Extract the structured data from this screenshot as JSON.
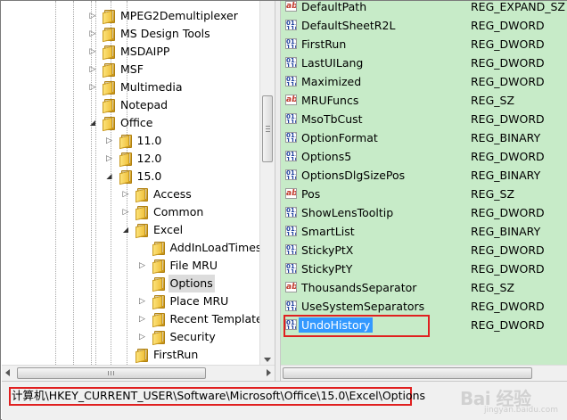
{
  "tree": {
    "items": [
      {
        "label": "MPEG2Demultiplexer",
        "depth": 0,
        "twisty": "collapsed"
      },
      {
        "label": "MS Design Tools",
        "depth": 0,
        "twisty": "collapsed"
      },
      {
        "label": "MSDAIPP",
        "depth": 0,
        "twisty": "collapsed"
      },
      {
        "label": "MSF",
        "depth": 0,
        "twisty": "collapsed"
      },
      {
        "label": "Multimedia",
        "depth": 0,
        "twisty": "collapsed"
      },
      {
        "label": "Notepad",
        "depth": 0,
        "twisty": "none"
      },
      {
        "label": "Office",
        "depth": 0,
        "twisty": "expanded"
      },
      {
        "label": "11.0",
        "depth": 1,
        "twisty": "collapsed"
      },
      {
        "label": "12.0",
        "depth": 1,
        "twisty": "collapsed"
      },
      {
        "label": "15.0",
        "depth": 1,
        "twisty": "expanded"
      },
      {
        "label": "Access",
        "depth": 2,
        "twisty": "collapsed"
      },
      {
        "label": "Common",
        "depth": 2,
        "twisty": "collapsed"
      },
      {
        "label": "Excel",
        "depth": 2,
        "twisty": "expanded"
      },
      {
        "label": "AddInLoadTimes",
        "depth": 3,
        "twisty": "none"
      },
      {
        "label": "File MRU",
        "depth": 3,
        "twisty": "collapsed"
      },
      {
        "label": "Options",
        "depth": 3,
        "twisty": "none",
        "selected": true
      },
      {
        "label": "Place MRU",
        "depth": 3,
        "twisty": "collapsed"
      },
      {
        "label": "Recent Templates",
        "depth": 3,
        "twisty": "collapsed"
      },
      {
        "label": "Security",
        "depth": 3,
        "twisty": "collapsed"
      },
      {
        "label": "FirstRun",
        "depth": 2,
        "twisty": "none"
      }
    ]
  },
  "values": {
    "rows": [
      {
        "name": "DefaultPath",
        "type": "REG_EXPAND_SZ",
        "icon": "ab"
      },
      {
        "name": "DefaultSheetR2L",
        "type": "REG_DWORD",
        "icon": "bin"
      },
      {
        "name": "FirstRun",
        "type": "REG_DWORD",
        "icon": "bin"
      },
      {
        "name": "LastUILang",
        "type": "REG_DWORD",
        "icon": "bin"
      },
      {
        "name": "Maximized",
        "type": "REG_DWORD",
        "icon": "bin"
      },
      {
        "name": "MRUFuncs",
        "type": "REG_SZ",
        "icon": "ab"
      },
      {
        "name": "MsoTbCust",
        "type": "REG_DWORD",
        "icon": "bin"
      },
      {
        "name": "OptionFormat",
        "type": "REG_BINARY",
        "icon": "bin"
      },
      {
        "name": "Options5",
        "type": "REG_DWORD",
        "icon": "bin"
      },
      {
        "name": "OptionsDlgSizePos",
        "type": "REG_BINARY",
        "icon": "bin"
      },
      {
        "name": "Pos",
        "type": "REG_SZ",
        "icon": "ab"
      },
      {
        "name": "ShowLensTooltip",
        "type": "REG_DWORD",
        "icon": "bin"
      },
      {
        "name": "SmartList",
        "type": "REG_BINARY",
        "icon": "bin"
      },
      {
        "name": "StickyPtX",
        "type": "REG_DWORD",
        "icon": "bin"
      },
      {
        "name": "StickyPtY",
        "type": "REG_DWORD",
        "icon": "bin"
      },
      {
        "name": "ThousandsSeparator",
        "type": "REG_SZ",
        "icon": "ab"
      },
      {
        "name": "UseSystemSeparators",
        "type": "REG_DWORD",
        "icon": "bin"
      },
      {
        "name": "UndoHistory",
        "type": "REG_DWORD",
        "icon": "bin",
        "selected": true
      }
    ]
  },
  "status": {
    "path": "计算机\\HKEY_CURRENT_USER\\Software\\Microsoft\\Office\\15.0\\Excel\\Options"
  },
  "watermark": {
    "text": "Bai 经验",
    "sub": "jingyan.baidu.com"
  },
  "colors": {
    "values_bg": "#c7ebc8",
    "highlight_box": "#e02020",
    "selection": "#3399ff"
  }
}
